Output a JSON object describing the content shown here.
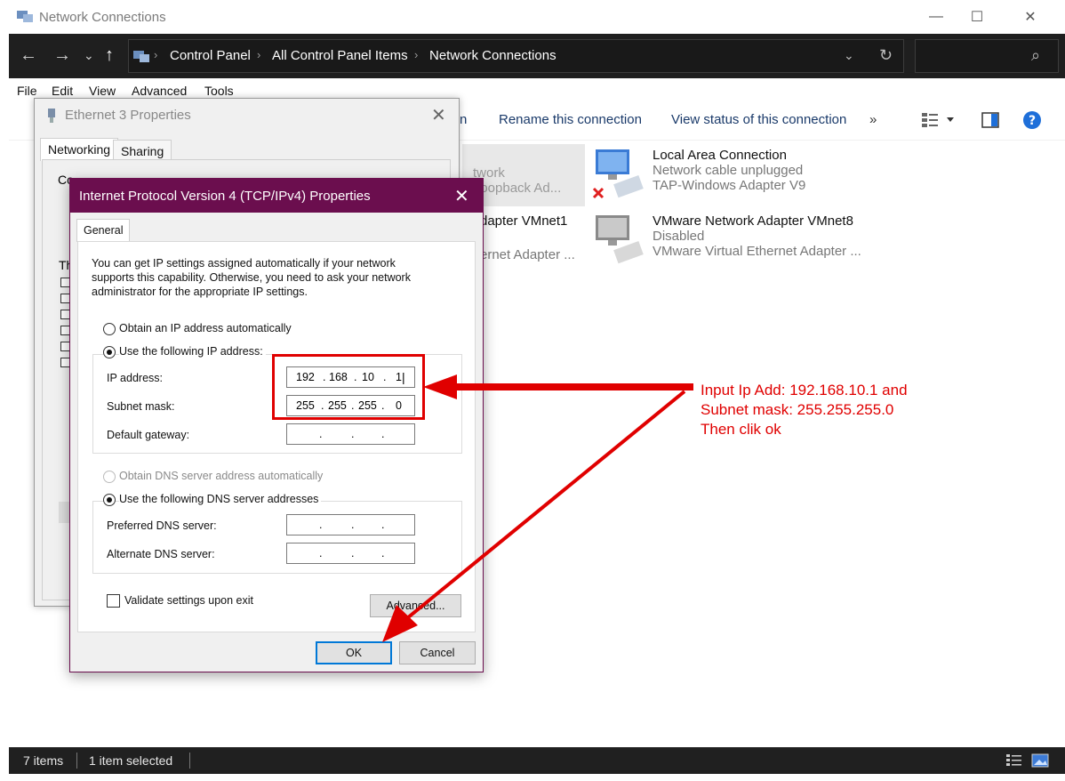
{
  "window": {
    "title": "Network Connections",
    "controls": {
      "minimize": "—",
      "maximize": "☐",
      "close": "✕"
    }
  },
  "nav": {
    "back": "←",
    "forward": "→",
    "recent": "⌄",
    "up": "↑",
    "breadcrumbs": [
      "Control Panel",
      "All Control Panel Items",
      "Network Connections"
    ],
    "refresh": "↻",
    "search_icon": "⌕"
  },
  "menu": [
    "File",
    "Edit",
    "View",
    "Advanced",
    "Tools"
  ],
  "commands": [
    "n",
    "Rename this connection",
    "View status of this connection",
    "»"
  ],
  "items": [
    {
      "name": "twork",
      "sub": "Loopback Ad..."
    },
    {
      "name": "Local Area Connection",
      "sub1": "Network cable unplugged",
      "sub2": "TAP-Windows Adapter V9"
    },
    {
      "name": "dapter VMnet1",
      "sub": "ernet Adapter ..."
    },
    {
      "name": "VMware Network Adapter VMnet8",
      "sub1": "Disabled",
      "sub2": "VMware Virtual Ethernet Adapter ..."
    }
  ],
  "status": {
    "count": "7 items",
    "selected": "1 item selected"
  },
  "eth_dialog": {
    "title": "Ethernet 3 Properties",
    "tabs": [
      "Networking",
      "Sharing"
    ],
    "partial": [
      "Co",
      "Th"
    ]
  },
  "ipv4_dialog": {
    "title": "Internet Protocol Version 4 (TCP/IPv4) Properties",
    "tab": "General",
    "intro": [
      "You can get IP settings assigned automatically if your network",
      "supports this capability. Otherwise, you need to ask your network",
      "administrator for the appropriate IP settings."
    ],
    "obtain_auto": "Obtain an IP address automatically",
    "use_following": "Use the following IP address:",
    "ip_label": "IP address:",
    "ip": [
      "192",
      "168",
      "10",
      "1"
    ],
    "mask_label": "Subnet mask:",
    "mask": [
      "255",
      "255",
      "255",
      "0"
    ],
    "gateway_label": "Default gateway:",
    "dns_auto": "Obtain DNS server address automatically",
    "dns_use": "Use the following DNS server addresses",
    "pref_dns_label": "Preferred DNS server:",
    "alt_dns_label": "Alternate DNS server:",
    "validate": "Validate settings upon exit",
    "advanced": "Advanced...",
    "ok": "OK",
    "cancel": "Cancel"
  },
  "annotation": {
    "lines": [
      "Input Ip Add: 192.168.10.1 and",
      "Subnet mask: 255.255.255.0",
      "Then clik ok"
    ],
    "color": "#e00000"
  }
}
